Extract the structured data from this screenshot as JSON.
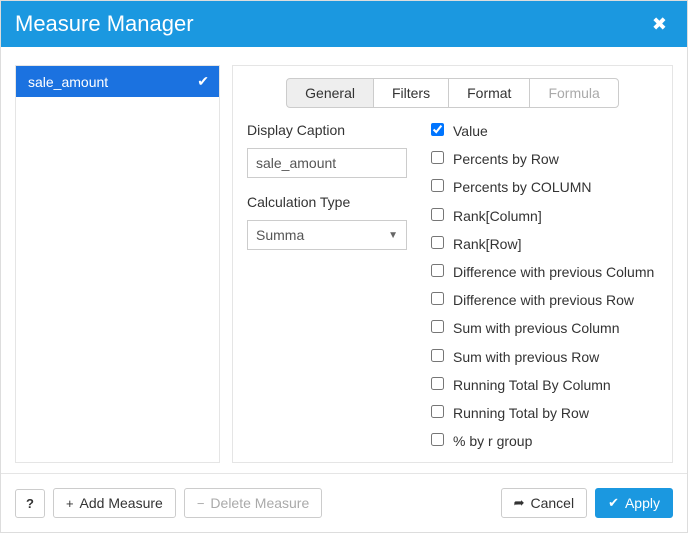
{
  "header": {
    "title": "Measure Manager",
    "close_icon": "✖"
  },
  "sidebar": {
    "items": [
      {
        "label": "sale_amount",
        "check": "✔"
      }
    ]
  },
  "tabs": {
    "general": "General",
    "filters": "Filters",
    "format": "Format",
    "formula": "Formula"
  },
  "form": {
    "display_caption_label": "Display Caption",
    "display_caption_value": "sale_amount",
    "calc_type_label": "Calculation Type",
    "calc_type_value": "Summa"
  },
  "options": [
    {
      "label": "Value",
      "checked": true
    },
    {
      "label": "Percents by Row",
      "checked": false
    },
    {
      "label": "Percents by COLUMN",
      "checked": false
    },
    {
      "label": "Rank[Column]",
      "checked": false
    },
    {
      "label": "Rank[Row]",
      "checked": false
    },
    {
      "label": "Difference with previous Column",
      "checked": false
    },
    {
      "label": "Difference with previous Row",
      "checked": false
    },
    {
      "label": "Sum with previous Column",
      "checked": false
    },
    {
      "label": "Sum with previous Row",
      "checked": false
    },
    {
      "label": "Running Total By Column",
      "checked": false
    },
    {
      "label": "Running Total by Row",
      "checked": false
    },
    {
      "label": "% by r group",
      "checked": false
    }
  ],
  "footer": {
    "help": "❓",
    "add_measure": "Add Measure",
    "delete_measure": "Delete Measure",
    "cancel": "Cancel",
    "apply": "Apply"
  }
}
